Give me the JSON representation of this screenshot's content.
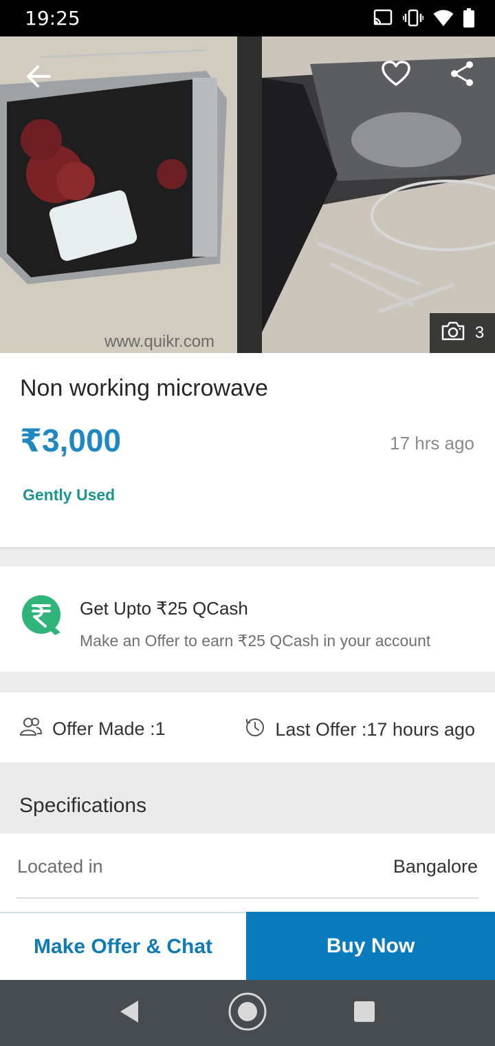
{
  "status_bar": {
    "time": "19:25"
  },
  "gallery": {
    "watermark": "www.quikr.com",
    "photo_count": "3"
  },
  "listing": {
    "title": "Non working microwave",
    "price": "₹3,000",
    "posted": "17 hrs ago",
    "condition": "Gently Used"
  },
  "qcash": {
    "title": "Get Upto ₹25 QCash",
    "subtitle": "Make an Offer to earn ₹25 QCash in your account"
  },
  "offers": {
    "made": "Offer Made :1",
    "last": "Last Offer :17 hours ago"
  },
  "specifications": {
    "heading": "Specifications",
    "rows": [
      {
        "label": "Located in",
        "value": "Bangalore"
      }
    ]
  },
  "actions": {
    "offer_label": "Make Offer & Chat",
    "buy_label": "Buy Now"
  },
  "colors": {
    "accent": "#1f88c2",
    "buy_button": "#0a7bbd",
    "condition": "#1b958f",
    "qcash_green": "#2fb57a"
  },
  "icons": [
    "cast-icon",
    "vibrate-icon",
    "wifi-icon",
    "battery-icon",
    "back-arrow-icon",
    "heart-icon",
    "share-icon",
    "camera-icon",
    "qcash-icon",
    "people-icon",
    "clock-icon",
    "nav-back-icon",
    "nav-home-icon",
    "nav-recents-icon"
  ]
}
